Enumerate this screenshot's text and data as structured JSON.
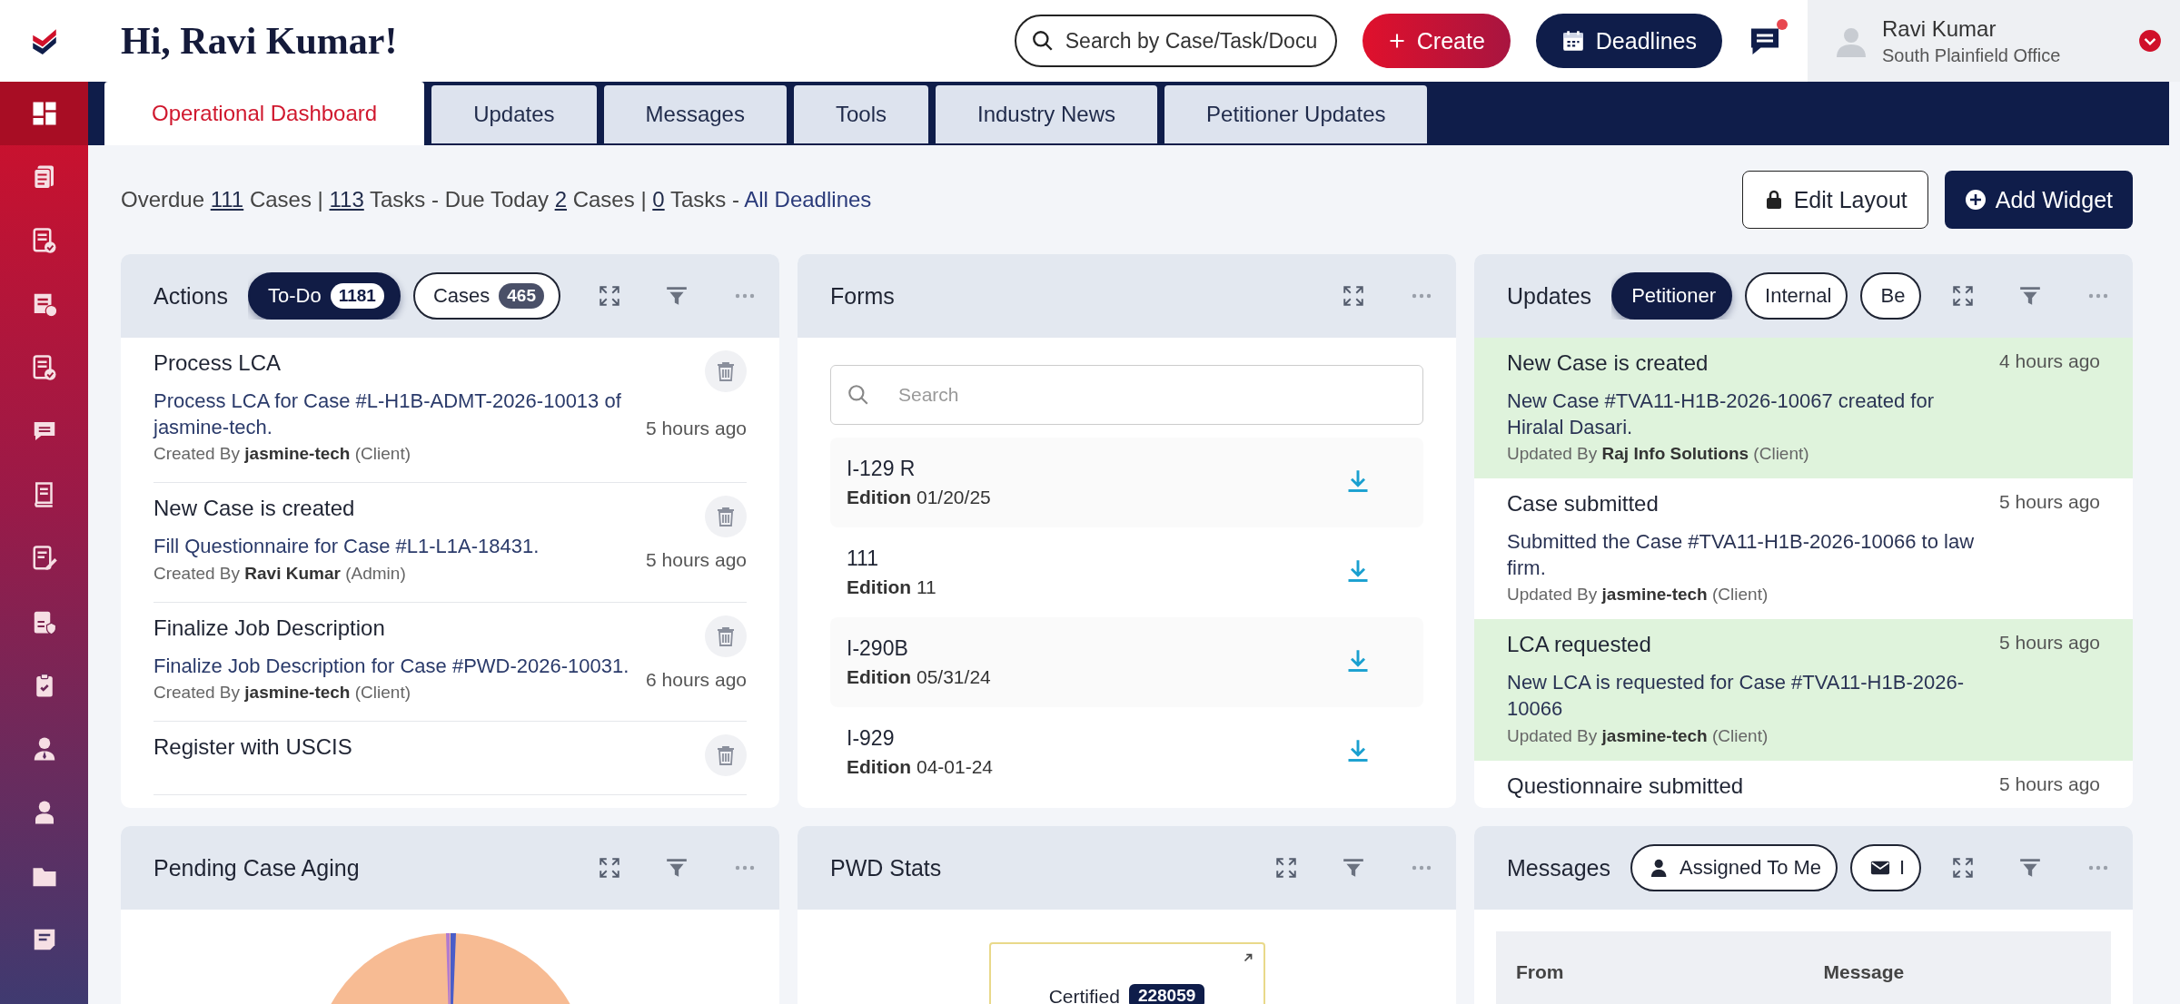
{
  "sidebar": {
    "items": [
      {
        "kind": "dashboard",
        "selected": true
      },
      {
        "kind": "documents",
        "selected": false
      },
      {
        "kind": "doc-check",
        "selected": false
      },
      {
        "kind": "invoice",
        "selected": false
      },
      {
        "kind": "doc-check",
        "selected": false
      },
      {
        "kind": "chat",
        "selected": false
      },
      {
        "kind": "book",
        "selected": false
      },
      {
        "kind": "edit",
        "selected": false
      },
      {
        "kind": "badge-doc",
        "selected": false
      },
      {
        "kind": "clipboard",
        "selected": false
      },
      {
        "kind": "user-tie",
        "selected": false
      },
      {
        "kind": "user",
        "selected": false
      },
      {
        "kind": "folder",
        "selected": false
      },
      {
        "kind": "note",
        "selected": false
      }
    ]
  },
  "header": {
    "greeting": "Hi, Ravi Kumar!",
    "search": {
      "placeholder": "Search by Case/Task/Docu"
    },
    "create": "Create",
    "deadlines": "Deadlines",
    "chat_unread": true,
    "user": {
      "name": "Ravi Kumar",
      "office": "South Plainfield Office"
    }
  },
  "tabs": [
    {
      "label": "Operational Dashboard",
      "selected": true
    },
    {
      "label": "Updates",
      "selected": false
    },
    {
      "label": "Messages",
      "selected": false
    },
    {
      "label": "Tools",
      "selected": false
    },
    {
      "label": "Industry News",
      "selected": false
    },
    {
      "label": "Petitioner Updates",
      "selected": false
    }
  ],
  "summary": [
    {
      "kind": "text",
      "text": "Overdue"
    },
    {
      "kind": "link",
      "text": "111"
    },
    {
      "kind": "text",
      "text": "Cases |"
    },
    {
      "kind": "link",
      "text": "113"
    },
    {
      "kind": "text",
      "text": "Tasks - Due Today"
    },
    {
      "kind": "link",
      "text": "2"
    },
    {
      "kind": "text",
      "text": "Cases |"
    },
    {
      "kind": "link",
      "text": "0"
    },
    {
      "kind": "text",
      "text": "Tasks -"
    },
    {
      "kind": "plain-link",
      "text": "All Deadlines"
    }
  ],
  "edit_layout": "Edit Layout",
  "add_widget": "Add Widget",
  "widgets": [
    {
      "kind": "actions",
      "title": "Actions",
      "chips": [
        {
          "label": "To-Do",
          "count": "1181",
          "selected": true
        },
        {
          "label": "Cases",
          "count": "465",
          "selected": false
        }
      ],
      "items": [
        {
          "title": "Process LCA",
          "description": "Process LCA for Case #L-H1B-ADMT-2026-10013 of jasmine-tech.",
          "by": "Created By **jasmine-tech** (Client)",
          "time": "5 hours ago"
        },
        {
          "title": "New Case is created",
          "description": "Fill Questionnaire for Case #L1-L1A-18431.",
          "by": "Created By **Ravi Kumar** (Admin)",
          "time": "5 hours ago"
        },
        {
          "title": "Finalize Job Description",
          "description": "Finalize Job Description for Case #PWD-2026-10031.",
          "by": "Created By **jasmine-tech** (Client)",
          "time": "6 hours ago"
        },
        {
          "title": "Register with USCIS"
        }
      ]
    },
    {
      "kind": "forms",
      "title": "Forms",
      "search": {
        "placeholder": "Search"
      },
      "items": [
        {
          "name": "I-129 R",
          "edition": "**Edition** 01/20/25"
        },
        {
          "name": "111",
          "edition": "**Edition** 11"
        },
        {
          "name": "I-290B",
          "edition": "**Edition** 05/31/24"
        },
        {
          "name": "I-929",
          "edition": "**Edition** 04-01-24"
        }
      ]
    },
    {
      "kind": "updates",
      "title": "Updates",
      "chips": [
        {
          "label": "Petitioner",
          "selected": true
        },
        {
          "label": "Internal",
          "selected": false
        },
        {
          "label": "Be",
          "selected": false
        }
      ],
      "items": [
        {
          "title": "New Case is created",
          "time": "4 hours ago",
          "description": "New Case #TVA11-H1B-2026-10067 created for Hiralal Dasari.",
          "by": "Updated By **Raj Info Solutions** (Client)",
          "highlighted": true
        },
        {
          "title": "Case submitted",
          "time": "5 hours ago",
          "description": "Submitted the Case #TVA11-H1B-2026-10066 to law firm.",
          "by": "Updated By **jasmine-tech** (Client)",
          "highlighted": false
        },
        {
          "title": "LCA requested",
          "time": "5 hours ago",
          "description": "New LCA is requested for Case #TVA11-H1B-2026-10066",
          "by": "Updated By **jasmine-tech** (Client)",
          "highlighted": true
        },
        {
          "title": "Questionnaire submitted",
          "time": "5 hours ago",
          "highlighted": false
        }
      ]
    },
    {
      "kind": "aging",
      "title": "Pending Case Aging"
    },
    {
      "kind": "pwd",
      "title": "PWD Stats",
      "stat": {
        "label": "Certified",
        "value": "228059"
      }
    },
    {
      "kind": "messages",
      "title": "Messages",
      "chips": [
        {
          "label": "Assigned To Me",
          "selected": false
        },
        {
          "label": "I",
          "selected": false
        }
      ],
      "columns": [
        "From",
        "Message"
      ]
    }
  ]
}
